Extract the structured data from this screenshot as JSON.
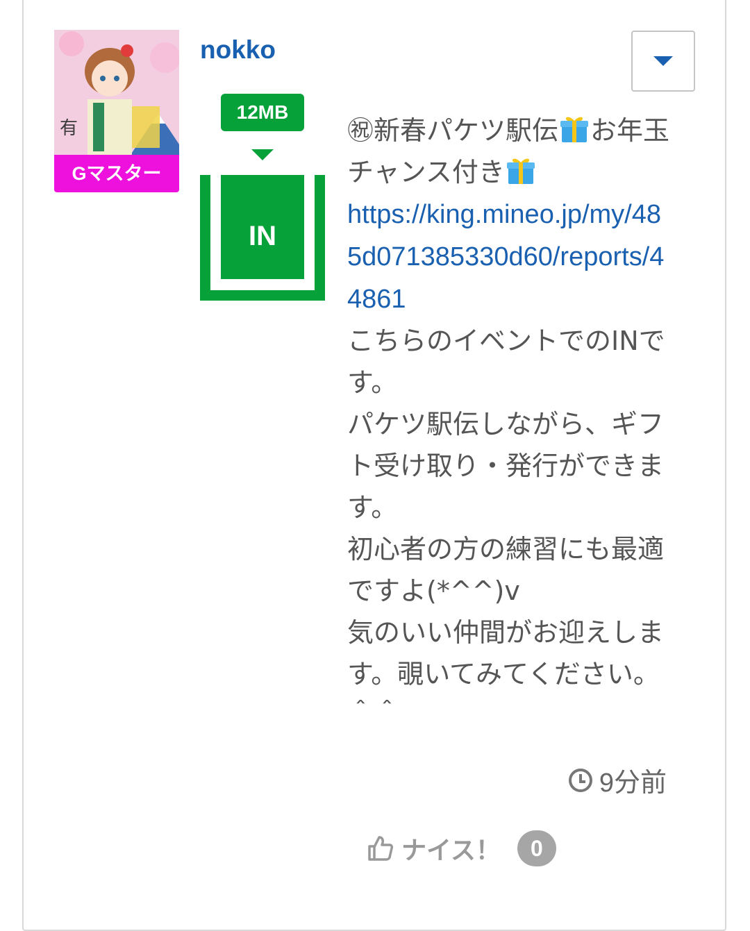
{
  "post": {
    "user": {
      "name": "nokko",
      "rank_badge": "Gマスター"
    },
    "capacity_badge": "12MB",
    "direction": "IN",
    "message": {
      "line1_a": "㊗新春パケツ駅伝",
      "line1_b": "お",
      "line2_a": "年玉チャンス付き",
      "link": "https://king.mineo.jp/my/485d071385330d60/reports/44861",
      "body": "こちらのイベントでのINです。\nパケツ駅伝しながら、ギフト受け取り・発行ができます。\n初心者の方の練習にも最適ですよ(*^^)v\n気のいい仲間がお迎えします。覗いてみてください。＾＾"
    },
    "timestamp": "9分前",
    "like_label": "ナイス！",
    "like_count": "0"
  },
  "icons": {
    "menu": "chevron-down-icon",
    "gift": "gift-emoji-icon",
    "time": "clock-icon",
    "like": "thumbs-up-icon"
  },
  "colors": {
    "link_blue": "#1a60b0",
    "in_green": "#07a13a",
    "badge_magenta": "#ee10dc",
    "like_gray": "#a6a6a6"
  }
}
